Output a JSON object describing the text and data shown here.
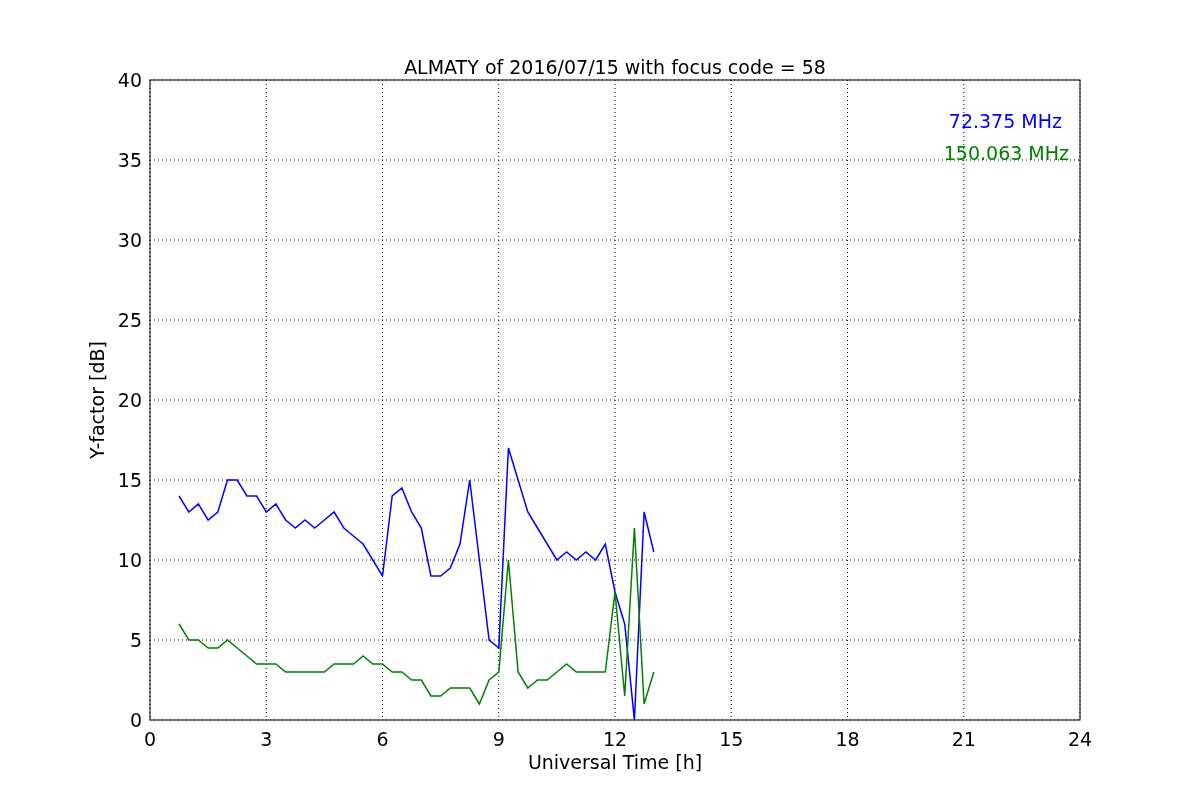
{
  "figure": {
    "chart_data": {
      "type": "line",
      "title": "ALMATY of 2016/07/15 with focus code = 58",
      "xlabel": "Universal Time [h]",
      "ylabel": "Y-factor [dB]",
      "x": [
        0.75,
        1,
        1.25,
        1.5,
        1.75,
        2,
        2.25,
        2.5,
        2.75,
        3,
        3.25,
        3.5,
        3.75,
        4,
        4.25,
        4.5,
        4.75,
        5,
        5.25,
        5.5,
        5.75,
        6,
        6.25,
        6.5,
        6.75,
        7,
        7.25,
        7.5,
        7.75,
        8,
        8.25,
        8.5,
        8.75,
        9,
        9.25,
        9.5,
        9.75,
        10,
        10.25,
        10.5,
        10.75,
        11,
        11.25,
        11.5,
        11.75,
        12,
        12.25,
        12.5,
        12.75,
        13
      ],
      "series": [
        {
          "name": "72.375 MHz",
          "color": "#0000ff",
          "values": [
            14,
            13,
            13.5,
            12.5,
            13,
            15,
            15,
            14,
            14,
            13,
            13.5,
            12.5,
            12,
            12.5,
            12,
            12.5,
            13,
            12,
            11.5,
            11,
            10,
            9,
            14,
            14.5,
            13,
            12,
            9,
            9,
            9.5,
            11,
            15,
            10,
            5,
            4.5,
            17,
            15,
            13,
            12,
            11,
            10,
            10.5,
            10,
            10.5,
            10,
            11,
            8,
            6,
            0,
            13,
            10.5
          ]
        },
        {
          "name": "150.063 MHz",
          "color": "#008000",
          "values": [
            6,
            5,
            5,
            4.5,
            4.5,
            5,
            4.5,
            4,
            3.5,
            3.5,
            3.5,
            3,
            3,
            3,
            3,
            3,
            3.5,
            3.5,
            3.5,
            4,
            3.5,
            3.5,
            3,
            3,
            2.5,
            2.5,
            1.5,
            1.5,
            2,
            2,
            2,
            1,
            2.5,
            3,
            10,
            3,
            2,
            2.5,
            2.5,
            3,
            3.5,
            3,
            3,
            3,
            3,
            8,
            1.5,
            12,
            1,
            3
          ]
        }
      ],
      "xlim": [
        0,
        24
      ],
      "ylim": [
        0,
        40
      ],
      "xticks": [
        0,
        3,
        6,
        9,
        12,
        15,
        18,
        21,
        24
      ],
      "yticks": [
        0,
        5,
        10,
        15,
        20,
        25,
        30,
        35,
        40
      ],
      "grid": true
    }
  }
}
